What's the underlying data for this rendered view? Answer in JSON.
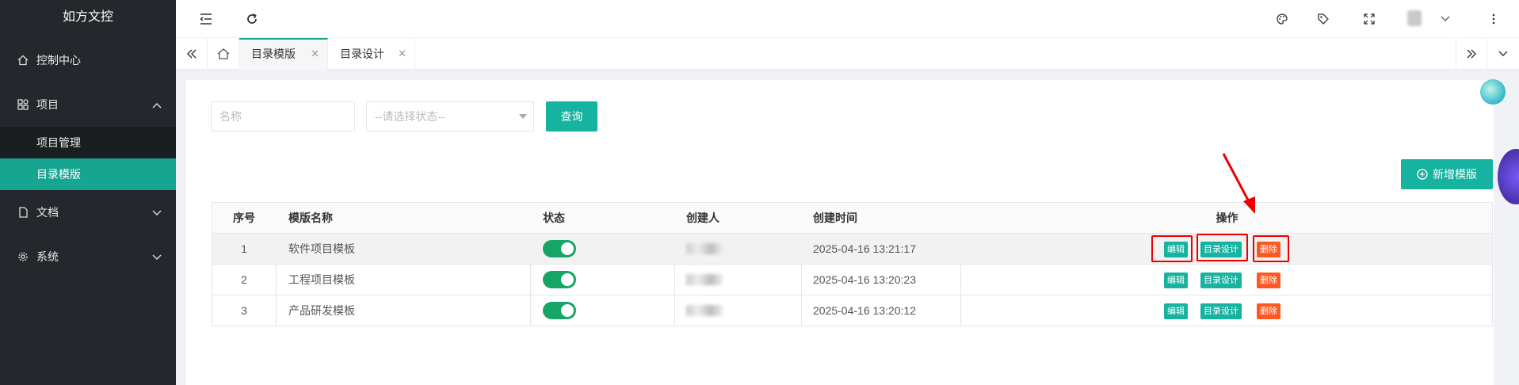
{
  "sidebar": {
    "brand": "如方文控",
    "items": [
      {
        "label": "控制中心",
        "icon": "home-icon"
      },
      {
        "label": "项目",
        "icon": "apps-icon",
        "expanded": true,
        "children": [
          {
            "label": "项目管理"
          },
          {
            "label": "目录模版",
            "active": true
          }
        ]
      },
      {
        "label": "文档",
        "icon": "file-icon"
      },
      {
        "label": "系统",
        "icon": "gear-icon"
      }
    ]
  },
  "header": {
    "icons": [
      "menu-fold-icon",
      "refresh-icon",
      "palette-icon",
      "tag-icon",
      "fullscreen-icon",
      "avatar",
      "chevron-down-icon",
      "more-vertical-icon"
    ]
  },
  "tabs": {
    "items": [
      {
        "label": "目录模版",
        "active": true
      },
      {
        "label": "目录设计"
      }
    ]
  },
  "search": {
    "name_placeholder": "名称",
    "status_placeholder": "--请选择状态--",
    "query_label": "查询",
    "add_label": "新增模版"
  },
  "table": {
    "columns": [
      "序号",
      "模版名称",
      "状态",
      "创建人",
      "创建时间",
      "操作"
    ],
    "rows": [
      {
        "index": "1",
        "name": "软件项目模板",
        "status": true,
        "creator": "",
        "created": "2025-04-16 13:21:17"
      },
      {
        "index": "2",
        "name": "工程项目模板",
        "status": true,
        "creator": "",
        "created": "2025-04-16 13:20:23"
      },
      {
        "index": "3",
        "name": "产品研发模板",
        "status": true,
        "creator": "",
        "created": "2025-04-16 13:20:12"
      }
    ],
    "actions": {
      "edit": "编辑",
      "design": "目录设计",
      "delete": "删除"
    }
  },
  "colors": {
    "accent": "#16b3a0",
    "sidebar": "#24282c",
    "danger": "#ff5722",
    "annotation": "#e00000"
  }
}
